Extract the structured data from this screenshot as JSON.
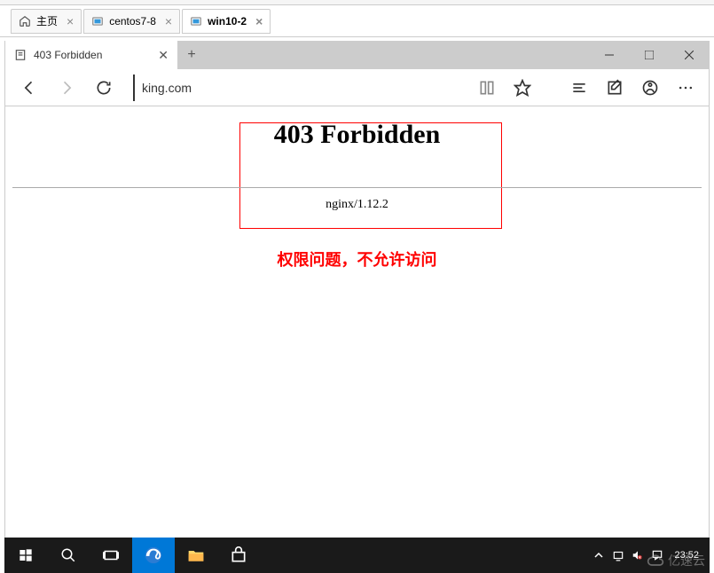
{
  "vm_tabs": [
    {
      "label": "主页",
      "icon": "home",
      "active": false
    },
    {
      "label": "centos7-8",
      "icon": "vm",
      "active": false
    },
    {
      "label": "win10-2",
      "icon": "vm",
      "active": true
    }
  ],
  "edge": {
    "tab_title": "403 Forbidden",
    "new_tab": "+",
    "address": "king.com",
    "window": {
      "minimize": "—",
      "maximize": "☐",
      "close": "✕"
    }
  },
  "page": {
    "error_title": "403 Forbidden",
    "server": "nginx/1.12.2",
    "annotation": "权限问题，不允许访问"
  },
  "taskbar": {
    "clock": "23:52"
  },
  "watermark": "亿速云"
}
